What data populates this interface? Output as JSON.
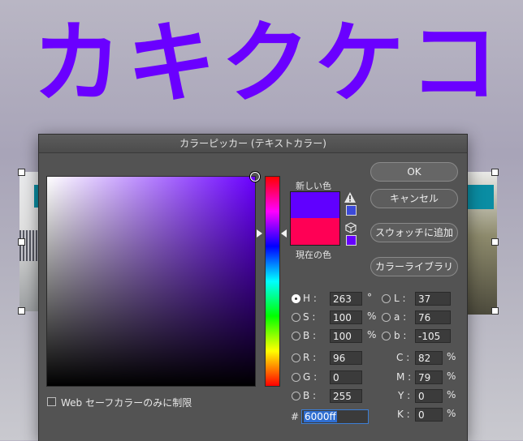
{
  "canvas": {
    "heading": "カキクケコ"
  },
  "dialog": {
    "title": "カラーピッカー (テキストカラー)",
    "new_label": "新しい色",
    "current_label": "現在の色",
    "new_color": "#6000ff",
    "current_color": "#ff0055",
    "buttons": {
      "ok": "OK",
      "cancel": "キャンセル",
      "add_swatch": "スウォッチに追加",
      "libraries": "カラーライブラリ"
    },
    "web_safe_label": "Web セーフカラーのみに制限",
    "hsb": {
      "h": {
        "label": "H :",
        "value": "263",
        "unit": "°"
      },
      "s": {
        "label": "S :",
        "value": "100",
        "unit": "%"
      },
      "b": {
        "label": "B :",
        "value": "100",
        "unit": "%"
      }
    },
    "rgb": {
      "r": {
        "label": "R :",
        "value": "96"
      },
      "g": {
        "label": "G :",
        "value": "0"
      },
      "b": {
        "label": "B :",
        "value": "255"
      }
    },
    "lab": {
      "l": {
        "label": "L :",
        "value": "37"
      },
      "a": {
        "label": "a :",
        "value": "76"
      },
      "b": {
        "label": "b :",
        "value": "-105"
      }
    },
    "cmyk": {
      "c": {
        "label": "C :",
        "value": "82",
        "unit": "%"
      },
      "m": {
        "label": "M :",
        "value": "79",
        "unit": "%"
      },
      "y": {
        "label": "Y :",
        "value": "0",
        "unit": "%"
      },
      "k": {
        "label": "K :",
        "value": "0",
        "unit": "%"
      }
    },
    "hex": {
      "label": "#",
      "value": "6000ff"
    }
  }
}
